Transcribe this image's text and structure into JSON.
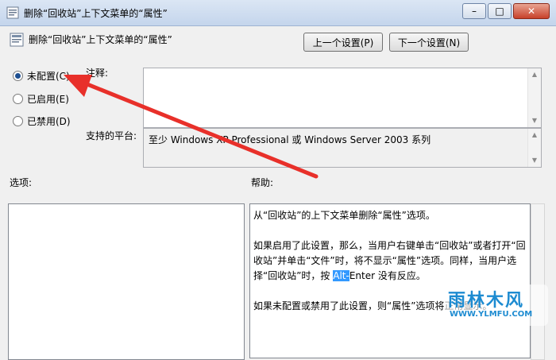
{
  "window": {
    "title": "删除“回收站”上下文菜单的“属性”",
    "min_glyph": "–",
    "max_glyph": "□",
    "close_glyph": "✕"
  },
  "header": {
    "policy_name": "删除“回收站”上下文菜单的“属性”",
    "prev_button": "上一个设置(P)",
    "next_button": "下一个设置(N)"
  },
  "state": {
    "options": [
      {
        "label": "未配置(C)",
        "checked": true
      },
      {
        "label": "已启用(E)",
        "checked": false
      },
      {
        "label": "已禁用(D)",
        "checked": false
      }
    ]
  },
  "labels": {
    "comment": "注释:",
    "platform": "支持的平台:",
    "options": "选项:",
    "help": "帮助:"
  },
  "platform_text": "至少 Windows XP Professional 或 Windows Server 2003 系列",
  "help": {
    "p1": "从“回收站”的上下文菜单删除“属性”选项。",
    "p2_a": "如果启用了此设置，那么，当用户右键单击“回收站”或者打开“回收站”并单击“文件”时，将不显示“属性”选项。同样，当用户选择“回收站”时，按 ",
    "p2_hl": "Alt-",
    "p2_b": "Enter 没有反应。",
    "p3": "如果未配置或禁用了此设置，则“属性”选项将正常显示。"
  },
  "watermark": {
    "logo": "雨林木风",
    "url": "WWW.YLMFU.COM"
  },
  "colors": {
    "arrow": "#e8302a",
    "accent": "#1e4f91"
  }
}
